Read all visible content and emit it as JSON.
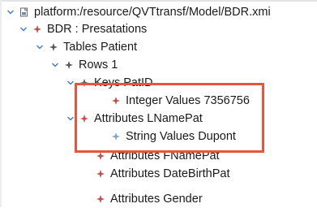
{
  "tree": {
    "root": {
      "label": "platform:/resource/QVTtransf/Model/BDR.xmi",
      "icon": "xmi-file-icon"
    },
    "presentations": {
      "label": "BDR : Presatations",
      "icon": "model-element-icon"
    },
    "tables_patient": {
      "label": "Tables Patient",
      "icon": "model-element-icon"
    },
    "rows_1": {
      "label": "Rows 1",
      "icon": "model-element-icon"
    },
    "keys_patid": {
      "label": "Keys PatID",
      "icon": "model-element-icon"
    },
    "integer_values": {
      "label": "Integer Values 7356756",
      "icon": "model-element-icon"
    },
    "attributes_lnamepat": {
      "label": "Attributes LNamePat",
      "icon": "model-element-icon"
    },
    "string_values": {
      "label": "String Values Dupont",
      "icon": "model-element-icon"
    },
    "attributes_fnamepat": {
      "label": "Attributes FNamePat",
      "icon": "model-element-icon"
    },
    "attributes_datebirthpat": {
      "label": "Attributes DateBirthPat",
      "icon": "model-element-icon"
    },
    "attributes_gender": {
      "label": "Attributes Gender",
      "icon": "model-element-icon"
    }
  },
  "colors": {
    "highlight_border": "#e4573d",
    "icon_dark": "#5b5b5b",
    "icon_red": "#c0504d",
    "icon_blue": "#7fa6c9"
  }
}
